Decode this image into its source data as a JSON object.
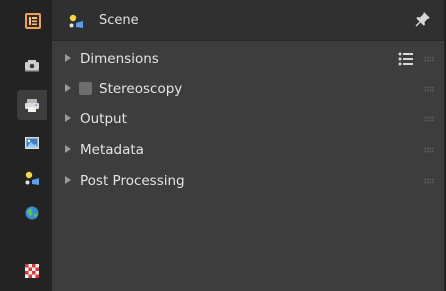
{
  "header": {
    "title": "Scene",
    "icon": "scene-icon",
    "pin_icon": "pin-icon"
  },
  "sidebar": {
    "tabs": [
      {
        "icon": "tool-icon",
        "active": false
      },
      {
        "icon": "render-icon",
        "active": false
      },
      {
        "icon": "output-icon",
        "active": true
      },
      {
        "icon": "view-layer-icon",
        "active": false
      },
      {
        "icon": "scene-icon",
        "active": false
      },
      {
        "icon": "world-icon",
        "active": false
      },
      {
        "icon": "texture-icon",
        "active": false
      }
    ]
  },
  "panels": [
    {
      "label": "Dimensions",
      "has_checkbox": false,
      "has_presets": true
    },
    {
      "label": "Stereoscopy",
      "has_checkbox": true,
      "checked": false
    },
    {
      "label": "Output",
      "has_checkbox": false
    },
    {
      "label": "Metadata",
      "has_checkbox": false
    },
    {
      "label": "Post Processing",
      "has_checkbox": false
    }
  ],
  "colors": {
    "editor_bg": "#3d3d3d",
    "sidebar_bg": "#232323",
    "header_bg": "#303030",
    "text": "#e3e3e3"
  }
}
